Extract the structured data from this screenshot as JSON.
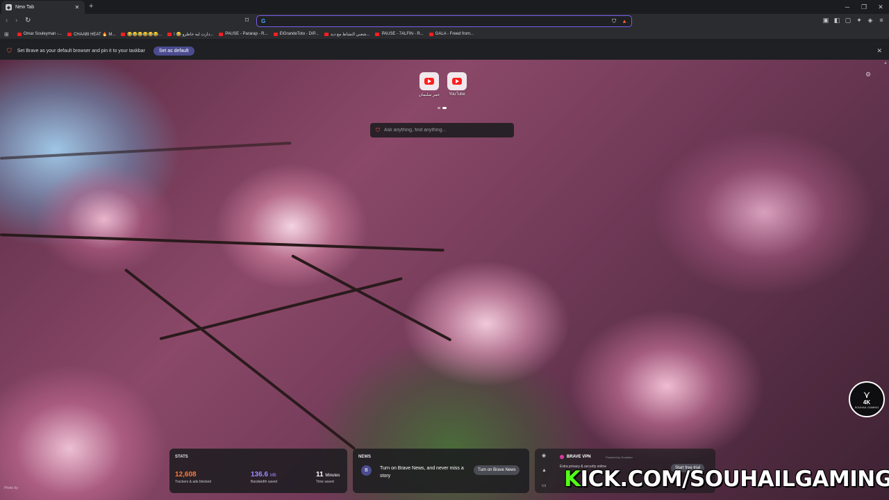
{
  "tab": {
    "title": "New Tab",
    "close": "✕",
    "new": "+"
  },
  "window": {
    "minimize": "─",
    "maximize": "❐",
    "close": "✕"
  },
  "nav": {
    "back": "‹",
    "forward": "›",
    "reload": "↻",
    "bookmark": "🔖"
  },
  "omnibox": {
    "value": "",
    "engine_icon": "G",
    "shield_icon": "shield-icon",
    "rewards_icon": "bat-icon"
  },
  "toolbar_right": [
    "▣",
    "◧",
    "▢",
    "✦",
    "◈",
    "≡"
  ],
  "bookmarks": [
    {
      "label": "Omar Souleyman -..."
    },
    {
      "label": "CHAABI HEAT 🔥 M..."
    },
    {
      "label": "😂😂😂😂😂😂..."
    },
    {
      "label": "دارت ليه خاطرو 😂 ا..."
    },
    {
      "label": "PAUSE - Pararap - R..."
    },
    {
      "label": "ElGrandeToto - DIP..."
    },
    {
      "label": "شعبي النشاط مع ديد..."
    },
    {
      "label": "PAUSE - 7ALFIN - R..."
    },
    {
      "label": "GALA - Freed from..."
    }
  ],
  "infobar": {
    "message": "Set Brave as your default browser and pin it to your taskbar",
    "button": "Set as default",
    "close": "✕"
  },
  "top_sites": [
    {
      "label": "عمر سليمان"
    },
    {
      "label": "YouTube"
    }
  ],
  "search": {
    "placeholder": "Ask anything, find anything..."
  },
  "stats": {
    "header": "STATS",
    "trackers": {
      "value": "12,608",
      "label": "Trackers & ads blocked"
    },
    "bandwidth": {
      "value": "136.6",
      "unit": "MB",
      "label": "Bandwidth saved"
    },
    "time": {
      "value": "11",
      "unit": "Minutes",
      "label": "Time saved"
    },
    "colors": {
      "trackers": "#ff7a35",
      "bandwidth": "#9b8cff",
      "time": "#ffffff"
    }
  },
  "news": {
    "header": "NEWS",
    "badge": "B",
    "text": "Turn on Brave News, and never miss a story",
    "button": "Turn on Brave News"
  },
  "vpn": {
    "title": "BRAVE VPN",
    "powered": "Powered by Guardian",
    "line": "Extra privacy & security online",
    "button": "Start free trial"
  },
  "overlay": {
    "kick_k": "K",
    "kick_rest": "ICK.COM/SOUHAILGAMING",
    "logo_text": "4K",
    "logo_sub": "SOUHAIL GAMING"
  },
  "photo_credit": "Photo by"
}
